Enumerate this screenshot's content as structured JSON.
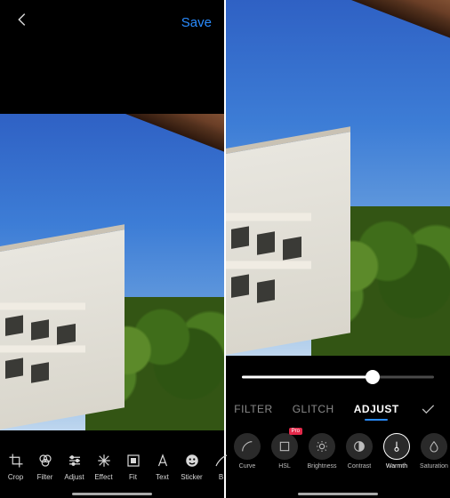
{
  "left": {
    "save_label": "Save",
    "tools": [
      {
        "name": "crop",
        "label": "Crop"
      },
      {
        "name": "filter",
        "label": "Filter"
      },
      {
        "name": "adjust",
        "label": "Adjust"
      },
      {
        "name": "effect",
        "label": "Effect"
      },
      {
        "name": "fit",
        "label": "Fit"
      },
      {
        "name": "text",
        "label": "Text"
      },
      {
        "name": "sticker",
        "label": "Sticker"
      },
      {
        "name": "brush",
        "label": "B"
      }
    ]
  },
  "right": {
    "slider_value_percent": 68,
    "tabs": [
      {
        "name": "filter",
        "label": "FILTER",
        "active": false
      },
      {
        "name": "glitch",
        "label": "GLITCH",
        "active": false
      },
      {
        "name": "adjust",
        "label": "ADJUST",
        "active": true
      }
    ],
    "adjust_items": [
      {
        "name": "curve",
        "label": "Curve",
        "selected": false,
        "pro": false
      },
      {
        "name": "hsl",
        "label": "HSL",
        "selected": false,
        "pro": true
      },
      {
        "name": "brightness",
        "label": "Brightness",
        "selected": false,
        "pro": false
      },
      {
        "name": "contrast",
        "label": "Contrast",
        "selected": false,
        "pro": false
      },
      {
        "name": "warmth",
        "label": "Warmth",
        "selected": true,
        "pro": false
      },
      {
        "name": "saturation",
        "label": "Saturation",
        "selected": false,
        "pro": false
      }
    ],
    "pro_badge": "Pro"
  }
}
